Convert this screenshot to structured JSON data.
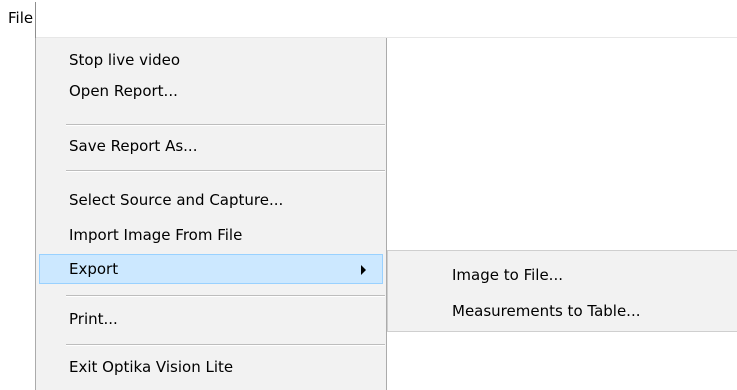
{
  "menubar": {
    "file_label": "File"
  },
  "file_menu": {
    "items": [
      {
        "label": "Stop live video"
      },
      {
        "label": "Open Report..."
      },
      {
        "label": "Save Report As..."
      },
      {
        "label": "Select Source and Capture..."
      },
      {
        "label": "Import Image From File"
      },
      {
        "label": "Export",
        "highlighted": true,
        "has_submenu": true
      },
      {
        "label": "Print..."
      },
      {
        "label": "Exit Optika Vision Lite"
      }
    ]
  },
  "export_submenu": {
    "items": [
      {
        "label": "Image to File..."
      },
      {
        "label": "Measurements to Table..."
      }
    ]
  },
  "colors": {
    "menu_background": "#f2f2f2",
    "highlight_fill": "#cce8ff",
    "highlight_border": "#99d1ff"
  },
  "icons": {
    "submenu_arrow": "chevron-right-icon"
  }
}
